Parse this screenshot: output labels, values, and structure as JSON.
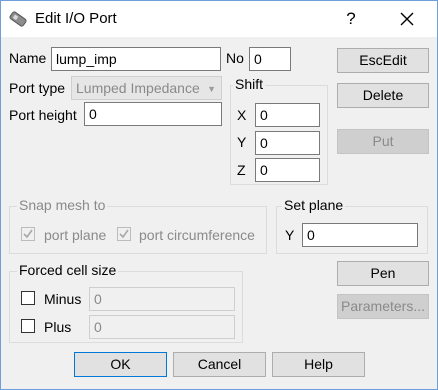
{
  "window": {
    "title": "Edit I/O Port",
    "help": "?"
  },
  "form": {
    "name_label": "Name",
    "name_value": "lump_imp",
    "no_label": "No",
    "no_value": "0",
    "port_type_label": "Port type",
    "port_type_value": "Lumped Impedance",
    "port_height_label": "Port height",
    "port_height_value": "0"
  },
  "shift": {
    "title": "Shift",
    "x_label": "X",
    "x_value": "0",
    "y_label": "Y",
    "y_value": "0",
    "z_label": "Z",
    "z_value": "0"
  },
  "side_buttons": {
    "escedit": "EscEdit",
    "delete": "Delete",
    "put": "Put",
    "pen": "Pen",
    "parameters": "Parameters..."
  },
  "snap": {
    "title": "Snap mesh to",
    "port_plane": "port plane",
    "port_circumference": "port circumference",
    "port_plane_checked": true,
    "port_circumference_checked": true
  },
  "set_plane": {
    "title": "Set plane",
    "y_label": "Y",
    "y_value": "0"
  },
  "forced": {
    "title": "Forced cell size",
    "minus_label": "Minus",
    "minus_value": "0",
    "minus_checked": false,
    "plus_label": "Plus",
    "plus_value": "0",
    "plus_checked": false
  },
  "bottom_buttons": {
    "ok": "OK",
    "cancel": "Cancel",
    "help": "Help"
  }
}
